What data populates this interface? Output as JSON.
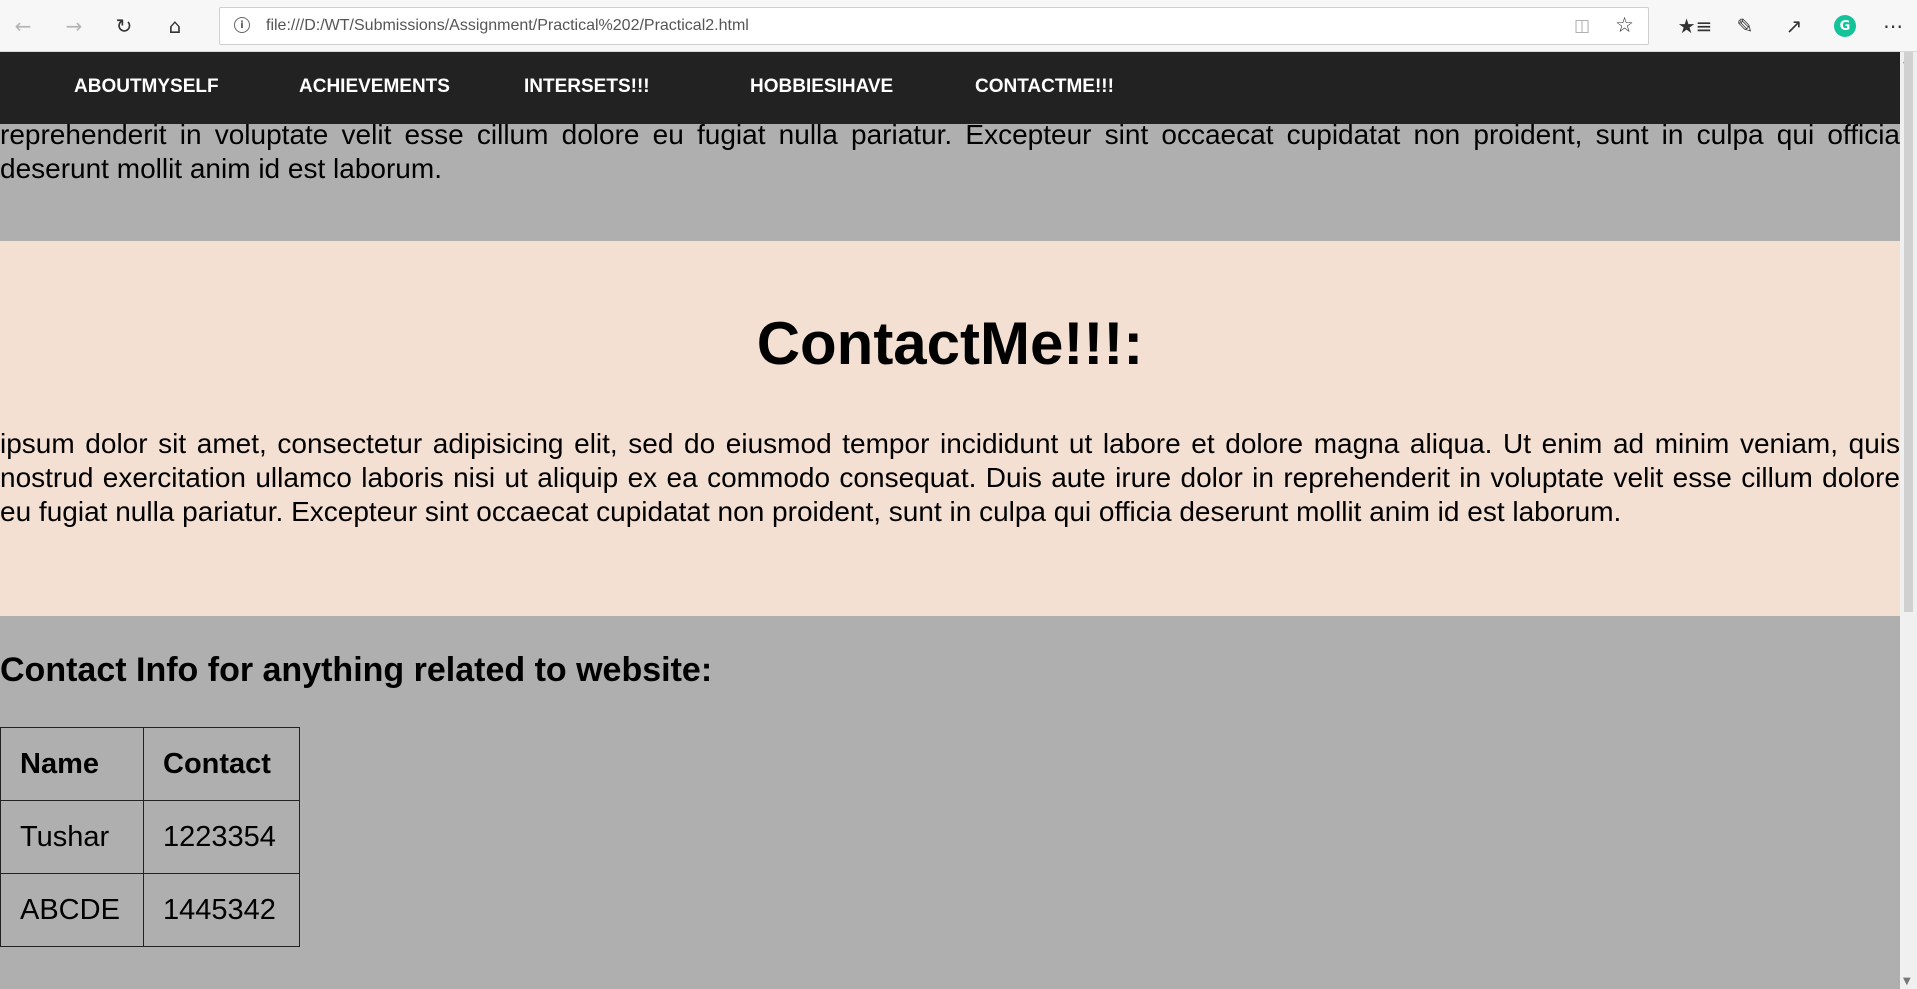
{
  "browser": {
    "url": "file:///D:/WT/Submissions/Assignment/Practical%202/Practical2.html",
    "icons": [
      "back-icon",
      "forward-icon",
      "refresh-icon",
      "home-icon",
      "site-info-icon",
      "reading-view-icon",
      "favorite-star-icon",
      "favorites-hub-icon",
      "pen-icon",
      "share-icon",
      "grammarly-icon",
      "more-icon"
    ]
  },
  "nav": {
    "items": [
      {
        "label": "ABOUTMYSELF"
      },
      {
        "label": "ACHIEVEMENTS"
      },
      {
        "label": "INTERSETS!!!"
      },
      {
        "label": "HOBBIESIHAVE"
      },
      {
        "label": "CONTACTME!!!"
      }
    ]
  },
  "content": {
    "top_paragraph": "reprehenderit in voluptate velit esse cillum dolore eu fugiat nulla pariatur. Excepteur sint occaecat cupidatat non proident, sunt in culpa qui officia deserunt mollit anim id est laborum.",
    "contact_section": {
      "title": "ContactMe!!!:",
      "paragraph": "ipsum dolor sit amet, consectetur adipisicing elit, sed do eiusmod tempor incididunt ut labore et dolore magna aliqua. Ut enim ad minim veniam, quis nostrud exercitation ullamco laboris nisi ut aliquip ex ea commodo consequat. Duis aute irure dolor in reprehenderit in voluptate velit esse cillum dolore eu fugiat nulla pariatur. Excepteur sint occaecat cupidatat non proident, sunt in culpa qui officia deserunt mollit anim id est laborum."
    },
    "info_heading": "Contact Info for anything related to website:",
    "table": {
      "headers": [
        "Name",
        "Contact"
      ],
      "rows": [
        [
          "Tushar",
          "1223354"
        ],
        [
          "ABCDE",
          "1445342"
        ]
      ]
    }
  },
  "colors": {
    "page_bg": "#afafaf",
    "nav_bg": "#222222",
    "contact_section_bg": "#f4e0d2",
    "grammarly": "#15c39a"
  }
}
